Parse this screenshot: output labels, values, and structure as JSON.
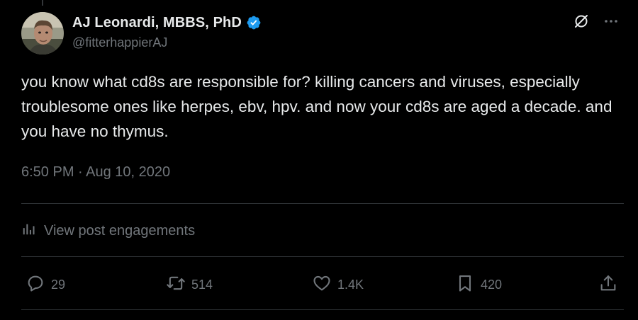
{
  "tweet": {
    "author": {
      "display_name": "AJ Leonardi, MBBS, PhD",
      "handle": "@fitterhappierAJ",
      "verified_icon": "verified-badge-icon"
    },
    "text": "you know what cd8s are responsible for? killing cancers and viruses, especially troublesome ones like herpes, ebv, hpv. and now your cd8s are aged a decade. and you have no thymus.",
    "timestamp": "6:50 PM · Aug 10, 2020",
    "engagements_label": "View post engagements",
    "actions": {
      "reply_count": "29",
      "repost_count": "514",
      "like_count": "1.4K",
      "bookmark_count": "420"
    },
    "icons": {
      "top": [
        "grok-icon",
        "more-icon"
      ],
      "actions": [
        "reply-icon",
        "repost-icon",
        "like-icon",
        "bookmark-icon",
        "share-icon"
      ],
      "engagements": "analytics-icon"
    }
  },
  "colors": {
    "background": "#000000",
    "text_primary": "#e7e9ea",
    "text_secondary": "#71767b",
    "divider": "#2f3336",
    "verified": "#1d9bf0"
  }
}
